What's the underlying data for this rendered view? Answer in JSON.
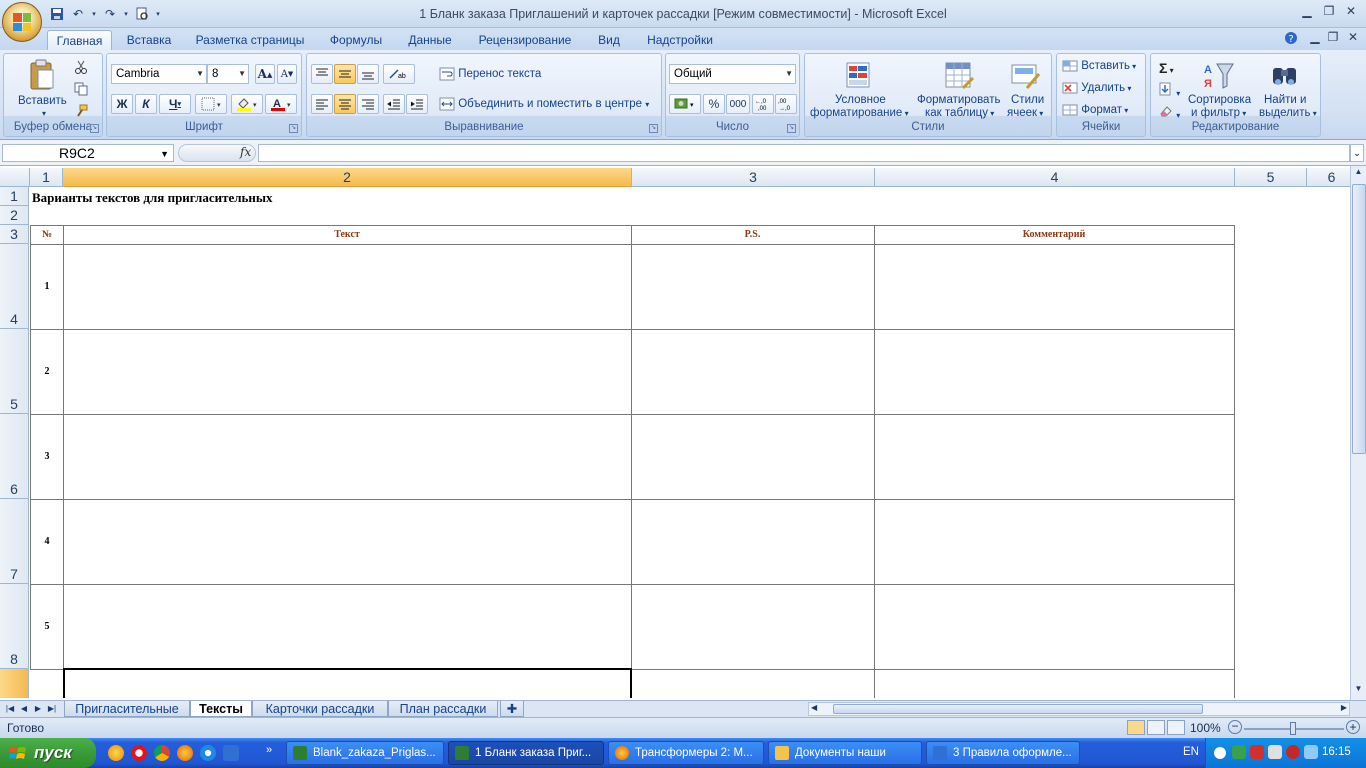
{
  "window": {
    "title": "1 Бланк заказа Приглашений и карточек рассадки  [Режим совместимости] - Microsoft Excel"
  },
  "ribbon_tabs": [
    "Главная",
    "Вставка",
    "Разметка страницы",
    "Формулы",
    "Данные",
    "Рецензирование",
    "Вид",
    "Надстройки"
  ],
  "groups": {
    "clipboard": {
      "label": "Буфер обмена",
      "paste": "Вставить"
    },
    "font": {
      "label": "Шрифт",
      "font_name": "Cambria",
      "font_size": "8",
      "bold": "Ж",
      "italic": "К",
      "underline": "Ч",
      "grow": "A",
      "shrink": "A"
    },
    "alignment": {
      "label": "Выравнивание",
      "wrap": "Перенос текста",
      "merge": "Объединить и поместить в центре"
    },
    "number": {
      "label": "Число",
      "format": "Общий",
      "percent": "%",
      "thousands": "000"
    },
    "styles": {
      "label": "Стили",
      "conditional_1": "Условное",
      "conditional_2": "форматирование",
      "table_1": "Форматировать",
      "table_2": "как таблицу",
      "cell_1": "Стили",
      "cell_2": "ячеек"
    },
    "cells": {
      "label": "Ячейки",
      "insert": "Вставить",
      "delete": "Удалить",
      "format": "Формат"
    },
    "editing": {
      "label": "Редактирование",
      "sum": "Σ",
      "sort_1": "Сортировка",
      "sort_2": "и фильтр",
      "find_1": "Найти и",
      "find_2": "выделить"
    }
  },
  "formula_bar": {
    "name_box": "R9C2",
    "fx": "fx",
    "content": ""
  },
  "column_headers": [
    "1",
    "2",
    "3",
    "4",
    "5",
    "6"
  ],
  "row_headers": [
    "1",
    "2",
    "3",
    "4",
    "5",
    "6",
    "7",
    "8",
    ""
  ],
  "sheet": {
    "title": "Варианты текстов для пригласительных",
    "table_headers": [
      "№",
      "Текст",
      "P.S.",
      "Комментарий"
    ],
    "row_numbers": [
      "1",
      "2",
      "3",
      "4",
      "5"
    ]
  },
  "sheet_tabs": [
    "Пригласительные",
    "Тексты",
    "Карточки рассадки",
    "План рассадки"
  ],
  "active_sheet": "Тексты",
  "status": {
    "ready": "Готово",
    "zoom": "100%"
  },
  "taskbar": {
    "start": "пуск",
    "buttons": [
      "Blank_zakaza_Priglas...",
      "1 Бланк заказа Приг...",
      "Трансформеры 2: М...",
      "Документы наши",
      "3 Правила оформле..."
    ],
    "lang": "EN",
    "clock": "16:15"
  },
  "colors": {
    "accent": "#f6b94d",
    "header_text": "#8a3a14",
    "ribbon_text": "#15428b",
    "taskbar": "#245edb"
  }
}
